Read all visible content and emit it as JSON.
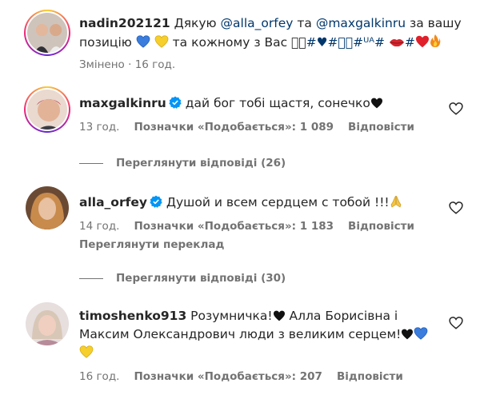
{
  "comments": [
    {
      "username": "nadin202121",
      "text_prefix": "Дякую ",
      "mention1": "@alla_orfey",
      "text_mid": " та ",
      "mention2": "@maxgalkinru",
      "text_after": " за вашу",
      "line2": "позицію",
      "line2_tail": " та кожному з Вас ",
      "tags": "⃣⃣#♥#⃣⃣#ᵁᴬ#",
      "edited": "Змінено",
      "time": "16 год."
    },
    {
      "username": "maxgalkinru",
      "text": "дай бог тобі щастя, сонечко",
      "time": "13 год.",
      "likes": "Позначки «Подобається»: 1 089",
      "reply": "Відповісти",
      "view_replies": "Переглянути відповіді (26)"
    },
    {
      "username": "alla_orfey",
      "text": "Душой и всем сердцем с тобой !!!",
      "time": "14 год.",
      "likes": "Позначки «Подобається»: 1 183",
      "reply": "Відповісти",
      "translate": "Переглянути переклад",
      "view_replies": "Переглянути відповіді (30)"
    },
    {
      "username": "timoshenko913",
      "text1": "Розумничка!",
      "text1_tail": " Алла Борисівна і",
      "text2": "Максим Олександрович люди з великим серцем!",
      "time": "16 год.",
      "likes": "Позначки «Подобається»: 207",
      "reply": "Відповісти"
    }
  ],
  "icons": {
    "verified": "verified-badge-icon",
    "like": "heart-outline-icon"
  },
  "colors": {
    "link": "#00376b",
    "meta": "#737373",
    "verified": "#0095f6"
  }
}
